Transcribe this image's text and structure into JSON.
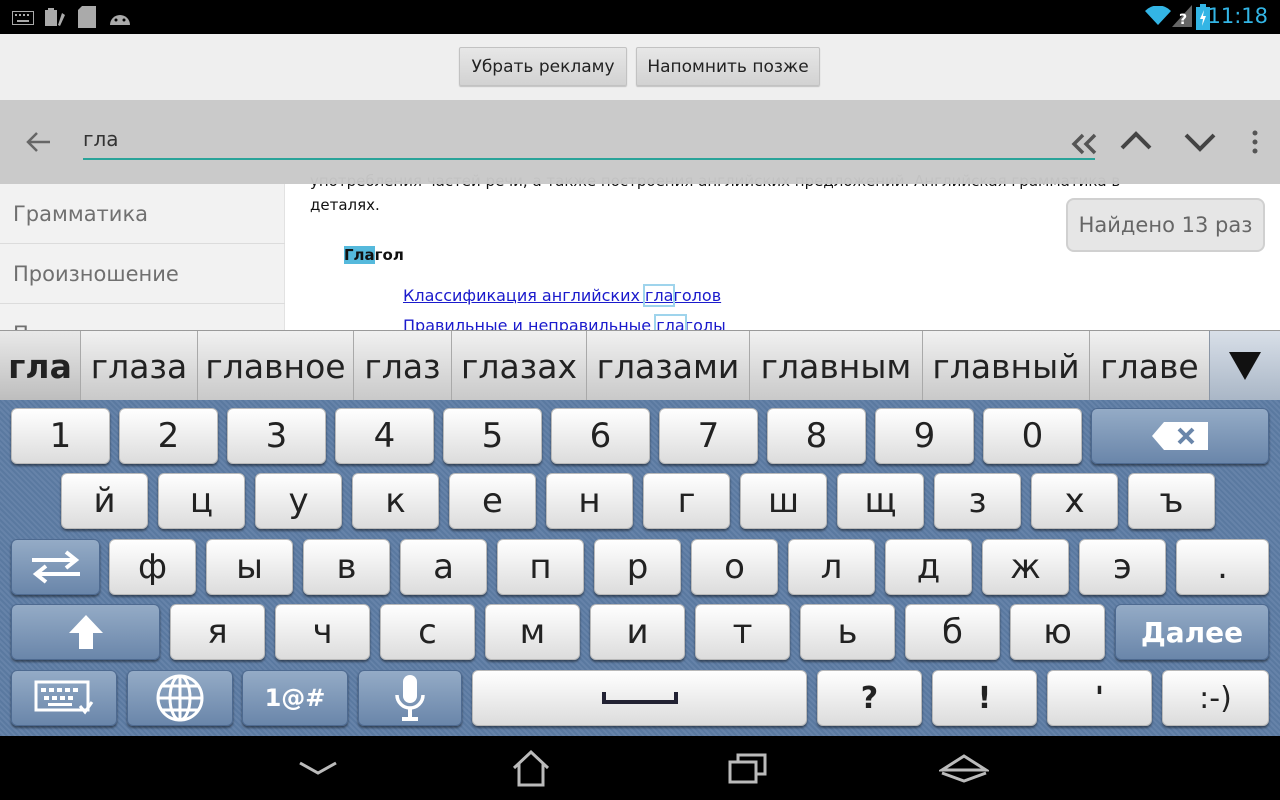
{
  "status_bar": {
    "time": "11:18",
    "time_color": "#33b5e5",
    "icons_left": [
      "keyboard-icon",
      "clipboard-icon",
      "sd-card-icon",
      "android-icon"
    ],
    "icons_right": [
      "wifi-icon",
      "question-signal-icon",
      "battery-charging-icon"
    ]
  },
  "ad_bar": {
    "remove_ads_label": "Убрать рекламу",
    "remind_later_label": "Напомнить позже"
  },
  "search": {
    "query": "гла",
    "accent_color": "#2aa399",
    "icons": [
      "back-arrow-icon",
      "clear-double-chevron-icon",
      "chevron-up-icon",
      "chevron-down-icon",
      "overflow-menu-icon"
    ]
  },
  "sidebar": {
    "items": [
      {
        "label": "Грамматика"
      },
      {
        "label": "Произношение"
      },
      {
        "label": "П"
      }
    ]
  },
  "article": {
    "clipped_line": "употребления частей речи, а также построения английских предложений. Английская грамматика в",
    "tail": "деталях.",
    "heading_match": "Гла",
    "heading_rest": "гол",
    "links": [
      {
        "before": "Классификация английских ",
        "match": "гла",
        "after": "голов"
      },
      {
        "before": "Правильные и неправильные ",
        "match": "гла",
        "after": "голы"
      }
    ],
    "match_color": "#55b9dc"
  },
  "found_badge": "Найдено 13 раз",
  "suggestions": [
    "гла",
    "глаза",
    "главное",
    "глаз",
    "глазах",
    "глазами",
    "главным",
    "главный",
    "главе"
  ],
  "keyboard": {
    "row1": [
      "1",
      "2",
      "3",
      "4",
      "5",
      "6",
      "7",
      "8",
      "9",
      "0"
    ],
    "row2": [
      "й",
      "ц",
      "у",
      "к",
      "е",
      "н",
      "г",
      "ш",
      "щ",
      "з",
      "х",
      "ъ"
    ],
    "row3": [
      "ф",
      "ы",
      "в",
      "а",
      "п",
      "р",
      "о",
      "л",
      "д",
      "ж",
      "э",
      "."
    ],
    "row4": [
      "я",
      "ч",
      "с",
      "м",
      "и",
      "т",
      "ь",
      "б",
      "ю"
    ],
    "enter_label": "Далее",
    "symbols_label": "1@#",
    "row5_punct": [
      "?",
      "!",
      "'",
      ":-)"
    ],
    "key_color": "#ffffff",
    "func_key_color": "#6a86aa"
  },
  "nav_bar": {
    "icons": [
      "nav-back-icon",
      "nav-home-icon",
      "nav-recents-icon",
      "nav-menu-icon"
    ]
  }
}
